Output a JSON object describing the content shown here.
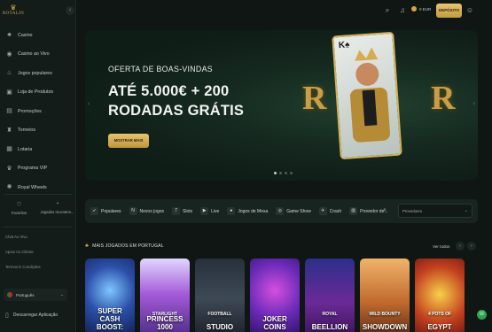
{
  "brand": {
    "name": "ROYALIN"
  },
  "sidebar": {
    "items": [
      {
        "label": "Casino",
        "icon": "casino-icon"
      },
      {
        "label": "Casino ao Vivo",
        "icon": "live-casino-icon"
      },
      {
        "label": "Jogos populares",
        "icon": "popular-icon"
      },
      {
        "label": "Loja de Produtos",
        "icon": "store-icon"
      },
      {
        "label": "Promoções",
        "icon": "gift-icon"
      },
      {
        "label": "Torneios",
        "icon": "trophy-icon"
      },
      {
        "label": "Lotaria",
        "icon": "lottery-icon"
      },
      {
        "label": "Programa VIP",
        "icon": "crown-icon"
      },
      {
        "label": "Royal Wheels",
        "icon": "wheel-icon"
      }
    ],
    "favorites_label": "Favoritos",
    "recent_label": "Jogados recentem...",
    "links": [
      "Chat Ao Vivo",
      "Apoio Ao Cliente",
      "Termos E Condições"
    ],
    "language": "Português",
    "download_label": "Descarregar Aplicação"
  },
  "header": {
    "balance": "0 EUR",
    "deposit_label": "DEPÓSITO"
  },
  "hero": {
    "eyebrow": "OFERTA DE BOAS-VINDAS",
    "title": "ATÉ 5.000€ + 200 RODADAS GRÁTIS",
    "button_label": "MOSTRAR MAIS",
    "slides": 4,
    "active_slide": 1
  },
  "categories": {
    "items": [
      {
        "label": "Populares",
        "icon": "rocket-icon"
      },
      {
        "label": "Novos jogos",
        "icon": "new-icon"
      },
      {
        "label": "Slots",
        "icon": "slot-icon"
      },
      {
        "label": "Live",
        "icon": "live-icon"
      },
      {
        "label": "Jogos de Mesa",
        "icon": "cards-icon"
      },
      {
        "label": "Game Show",
        "icon": "show-icon"
      },
      {
        "label": "Crash",
        "icon": "crash-icon"
      },
      {
        "label": "Provedor de...",
        "icon": "provider-icon"
      }
    ],
    "provider_placeholder": "Provedores"
  },
  "section": {
    "title": "MAIS JOGADOS EM PORTUGAL",
    "see_all": "Ver todos"
  },
  "games": [
    {
      "name": "SUPER CASH BOOST:",
      "sub": "",
      "badge": ""
    },
    {
      "name": "PRINCESS 1000",
      "sub": "STARLIGHT",
      "badge": ""
    },
    {
      "name": "STUDIO",
      "sub": "FOOTBALL",
      "badge": ""
    },
    {
      "name": "JOKER COINS",
      "sub": "",
      "badge": ""
    },
    {
      "name": "BEELLION",
      "sub": "ROYAL",
      "badge": ""
    },
    {
      "name": "SHOWDOWN",
      "sub": "WILD BOUNTY",
      "badge": ""
    },
    {
      "name": "EGYPT",
      "sub": "4 POTS OF",
      "badge": ""
    }
  ]
}
